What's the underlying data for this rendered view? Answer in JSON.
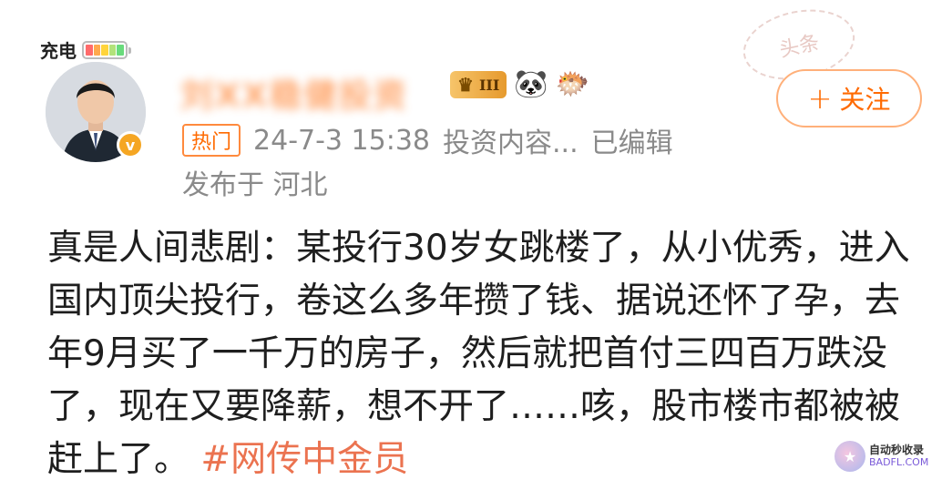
{
  "status": {
    "charge_label": "充电",
    "battery_colors": [
      "#ff6b6b",
      "#ffa94d",
      "#ffd43b",
      "#b2e27a",
      "#69db7c"
    ]
  },
  "post": {
    "author": "刘XX稳健投资",
    "level_badge": "III",
    "hot_tag": "热门",
    "timestamp": "24-7-3 15:38",
    "source": "投资内容...",
    "edited": "已编辑",
    "location": "发布于 河北",
    "follow_label": "关注",
    "follow_plus": "+",
    "text": "真是人间悲剧：某投行30岁女跳楼了，从小优秀，进入国内顶尖投行，卷这么多年攒了钱、据说还怀了孕，去年9月买了一千万的房子，然后就把首付三四百万跌没了，现在又要降薪，想不开了……咳，股市楼市都被被赶上了。",
    "hashtag": "#网传中金员",
    "stamp_text": "头条"
  },
  "watermark": {
    "title": "自动秒收录",
    "url": "BADFL.COM"
  },
  "icons": {
    "verified": "verified-v-icon",
    "crown": "crown-icon",
    "panda": "panda-icon",
    "fish": "fish-icon"
  }
}
